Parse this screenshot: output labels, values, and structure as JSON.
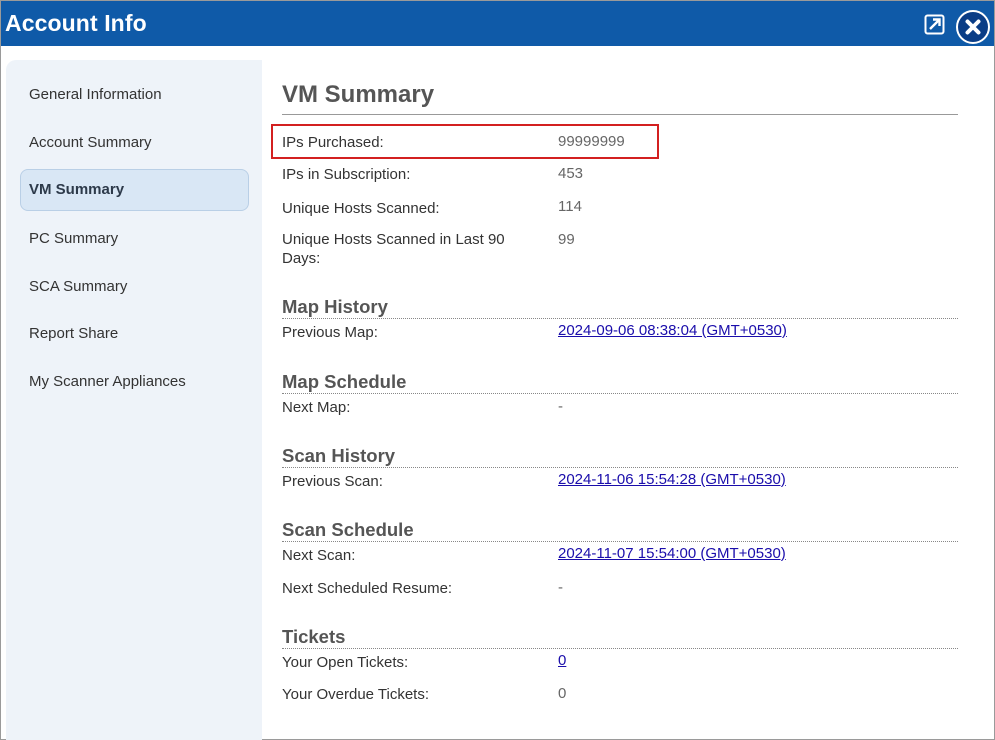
{
  "window": {
    "title": "Account Info"
  },
  "icons": {
    "popout": "popout-icon",
    "close": "close-icon"
  },
  "colors": {
    "titlebar": "#0f5aa8",
    "link": "#1a0dab",
    "highlight": "#d32020"
  },
  "sidebar": {
    "items": [
      {
        "label": "General Information",
        "active": false
      },
      {
        "label": "Account Summary",
        "active": false
      },
      {
        "label": "VM Summary",
        "active": true
      },
      {
        "label": "PC Summary",
        "active": false
      },
      {
        "label": "SCA Summary",
        "active": false
      },
      {
        "label": "Report Share",
        "active": false
      },
      {
        "label": "My Scanner Appliances",
        "active": false
      }
    ]
  },
  "main": {
    "title": "VM Summary",
    "summary": [
      {
        "label": "IPs Purchased:",
        "value": "99999999"
      },
      {
        "label": "IPs in Subscription:",
        "value": "453"
      },
      {
        "label": "Unique Hosts Scanned:",
        "value": "114"
      },
      {
        "label": "Unique Hosts Scanned in Last 90 Days:",
        "value": "99"
      }
    ],
    "map_history": {
      "title": "Map History",
      "previous_map_label": "Previous Map:",
      "previous_map_value": "2024-09-06 08:38:04 (GMT+0530)"
    },
    "map_schedule": {
      "title": "Map Schedule",
      "next_map_label": "Next Map:",
      "next_map_value": "-"
    },
    "scan_history": {
      "title": "Scan History",
      "previous_scan_label": "Previous Scan:",
      "previous_scan_value": "2024-11-06 15:54:28 (GMT+0530)"
    },
    "scan_schedule": {
      "title": "Scan Schedule",
      "next_scan_label": "Next Scan:",
      "next_scan_value": "2024-11-07 15:54:00 (GMT+0530)",
      "next_resume_label": "Next Scheduled Resume:",
      "next_resume_value": "-"
    },
    "tickets": {
      "title": "Tickets",
      "open_label": "Your Open Tickets:",
      "open_value": "0",
      "overdue_label": "Your Overdue Tickets:",
      "overdue_value": "0"
    }
  }
}
